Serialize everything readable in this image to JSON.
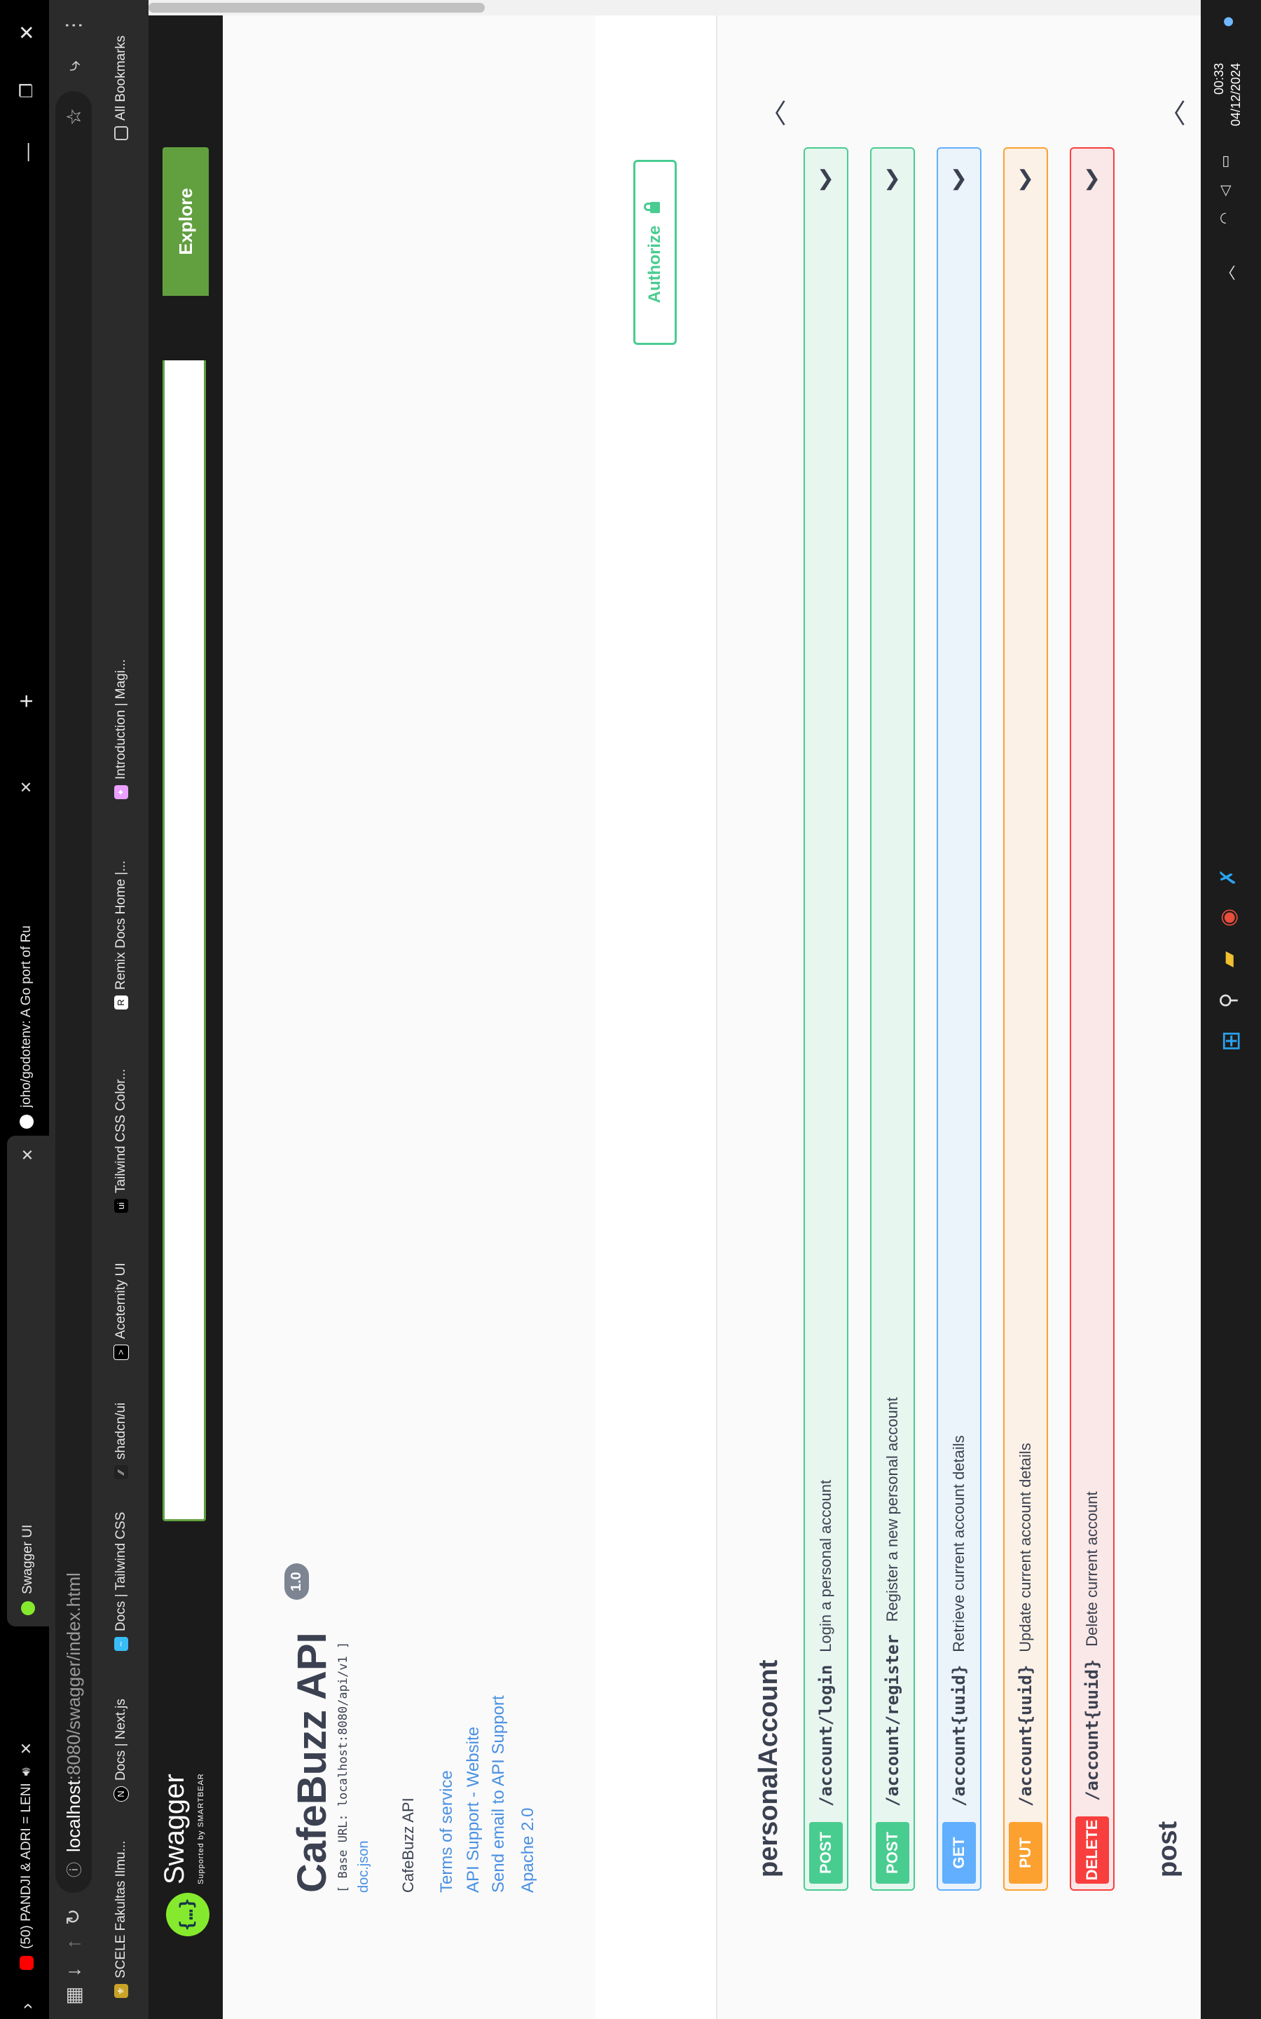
{
  "tabs": [
    {
      "title": "(50) PANDJI & ADRI = LENI",
      "favicon": "youtube-icon"
    },
    {
      "title": "Swagger UI",
      "favicon": "swagger-icon"
    },
    {
      "title": "joho/godotenv: A Go port of Ru",
      "favicon": "github-icon"
    }
  ],
  "address_bar": {
    "host": "localhost",
    "path": ":8080/swagger/index.html"
  },
  "bookmarks": [
    {
      "label": "SCELE Fakultas Ilmu..."
    },
    {
      "label": "Docs | Next.js"
    },
    {
      "label": "Docs | Tailwind CSS"
    },
    {
      "label": "shadcn/ui"
    },
    {
      "label": "Aceternity UI"
    },
    {
      "label": "Tailwind CSS Color..."
    },
    {
      "label": "Remix Docs Home |..."
    },
    {
      "label": "Introduction | Magi..."
    },
    {
      "label": "All Bookmarks"
    }
  ],
  "swagger": {
    "logo_text": "Swagger",
    "logo_sub": "Supported by SMARTBEAR",
    "explore_label": "Explore",
    "title": "CafeBuzz API",
    "version": "1.0",
    "base_url": "[ Base URL: localhost:8080/api/v1 ]",
    "doc_link": "doc.json",
    "description": "CafeBuzz API",
    "links": [
      "Terms of service",
      "API Support - Website",
      "Send email to API Support",
      "Apache 2.0"
    ],
    "authorize_label": "Authorize",
    "tags": [
      {
        "name": "personalAccount",
        "operations": [
          {
            "method": "POST",
            "path": "/account/login",
            "summary": "Login a personal account",
            "color": "#49cc90",
            "bg": "#e8f6f0"
          },
          {
            "method": "POST",
            "path": "/account/register",
            "summary": "Register a new personal account",
            "color": "#49cc90",
            "bg": "#e8f6f0"
          },
          {
            "method": "GET",
            "path": "/account{uuid}",
            "summary": "Retrieve current account details",
            "color": "#61affe",
            "bg": "#ebf3fb"
          },
          {
            "method": "PUT",
            "path": "/account{uuid}",
            "summary": "Update current account details",
            "color": "#fca130",
            "bg": "#fbf1e6"
          },
          {
            "method": "DELETE",
            "path": "/account{uuid}",
            "summary": "Delete current account",
            "color": "#f93e3e",
            "bg": "#fae7e7"
          }
        ]
      },
      {
        "name": "post",
        "operations": []
      }
    ]
  },
  "system": {
    "time": "00:33",
    "date": "04/12/2024"
  }
}
